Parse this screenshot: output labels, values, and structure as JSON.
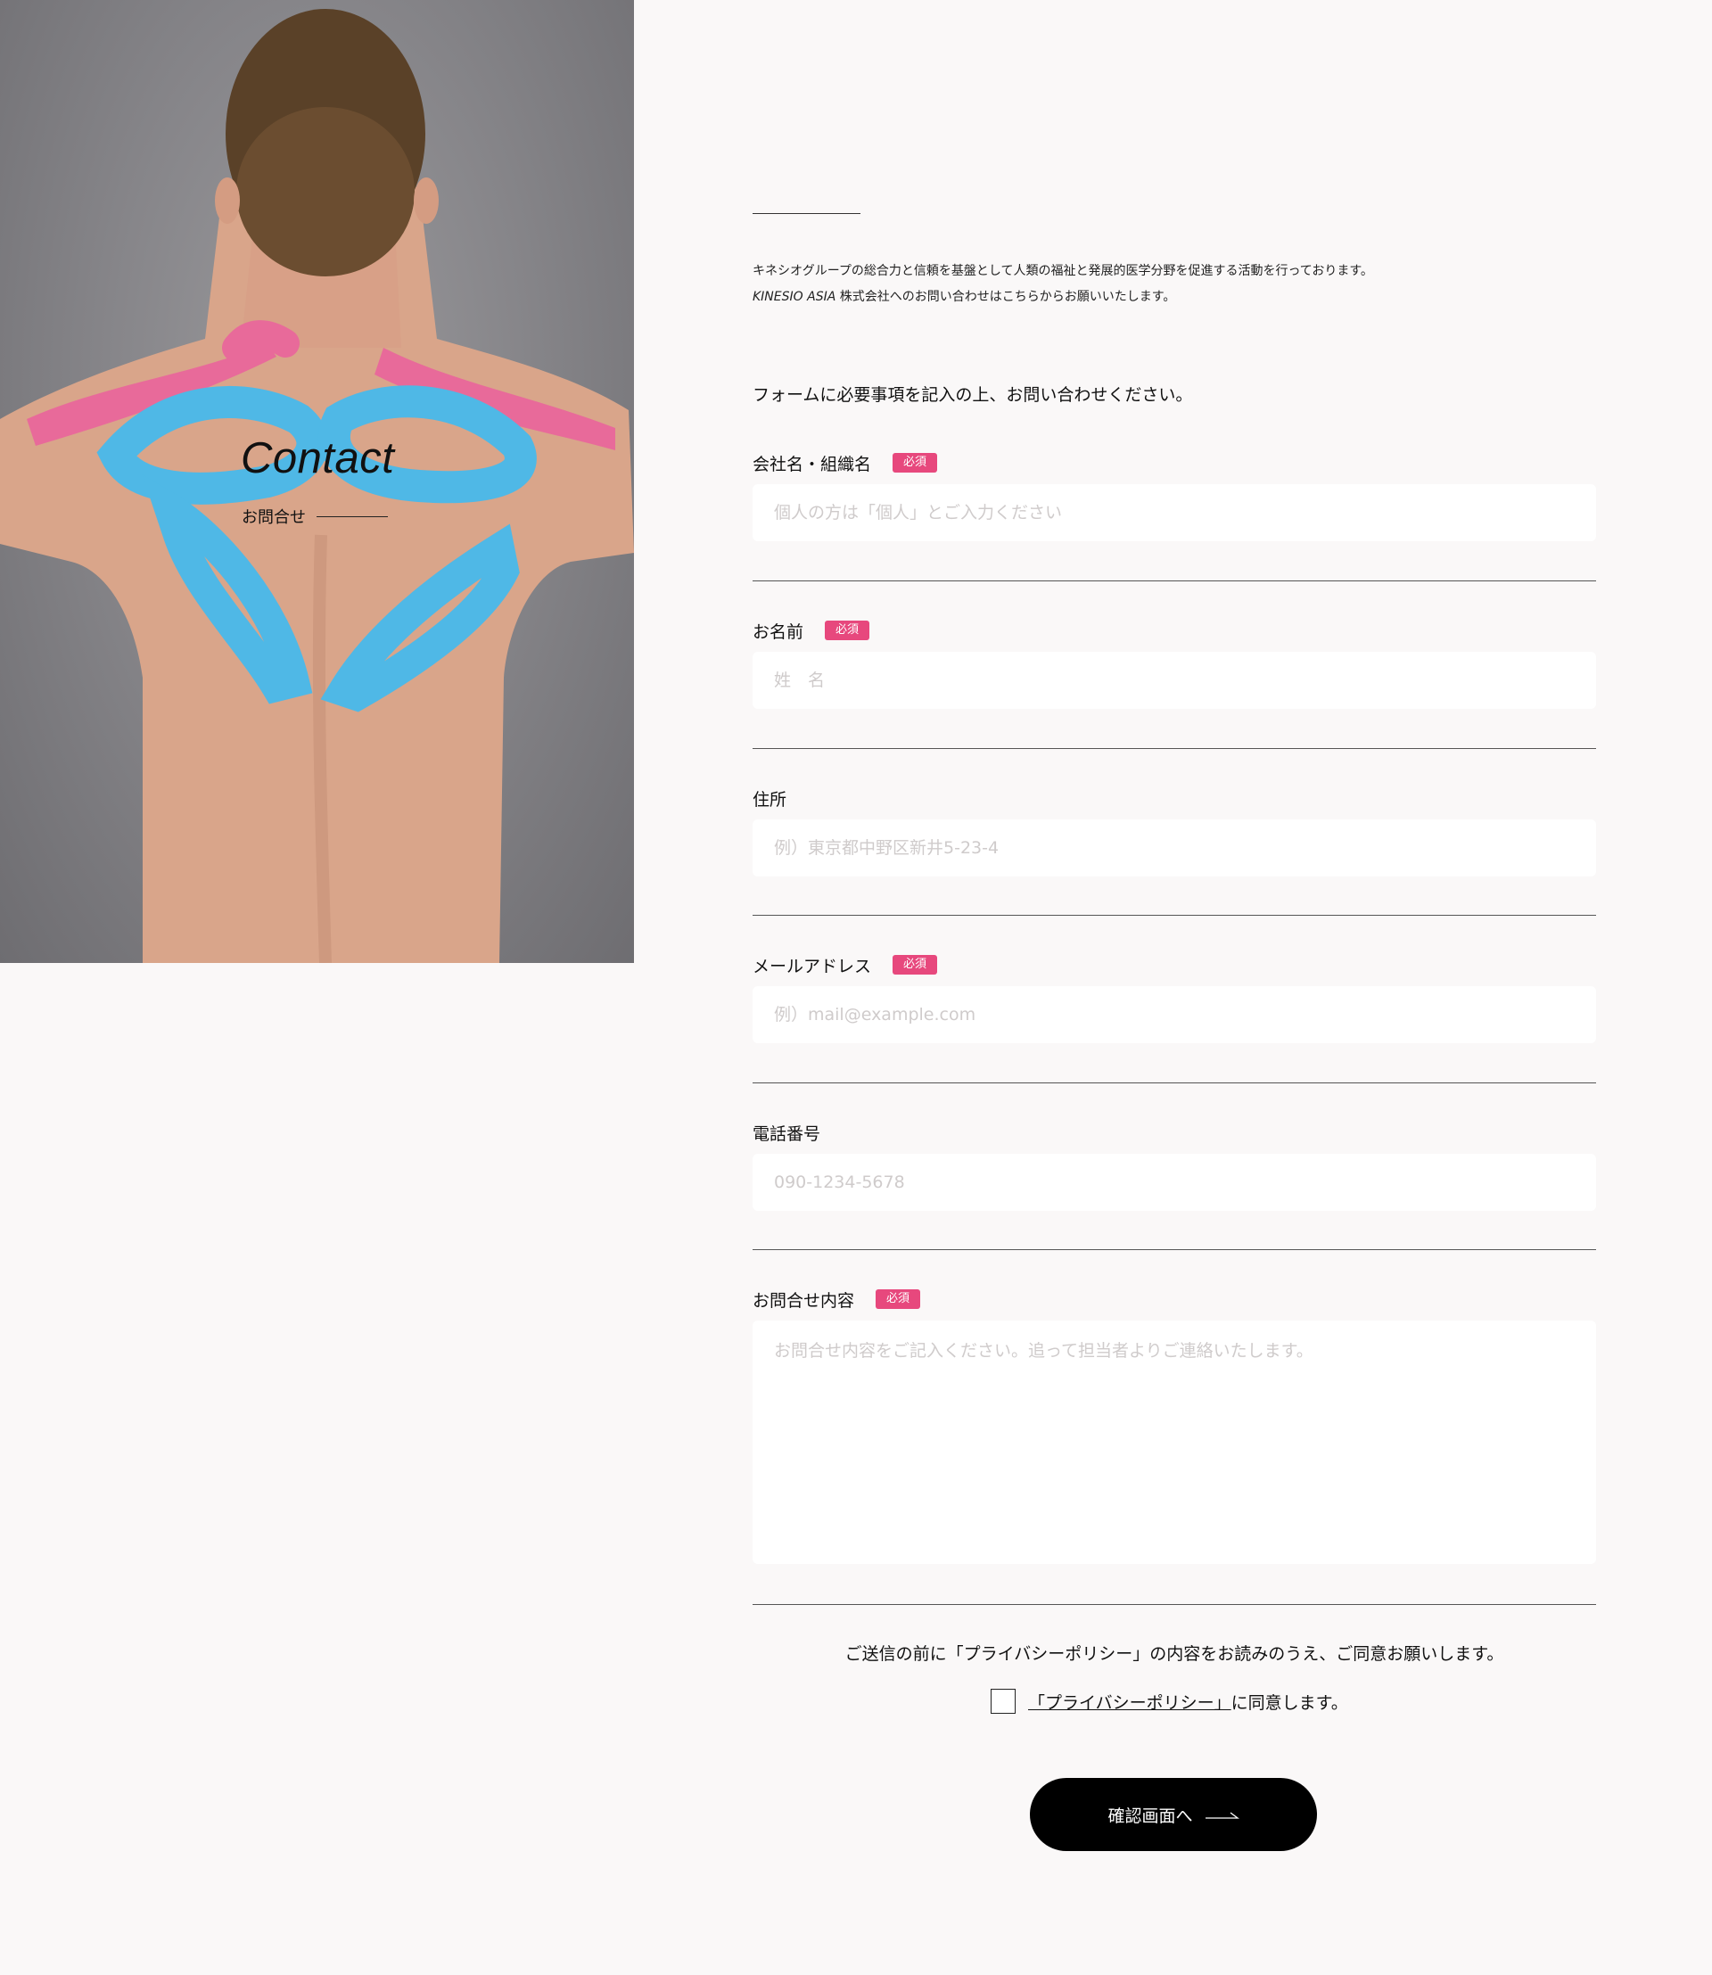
{
  "hero": {
    "title": "Contact",
    "subtitle": "お問合せ"
  },
  "intro": {
    "line1": "キネシオグループの総合力と信頼を基盤として人類の福祉と発展的医学分野を促進する活動を行っております。",
    "line2_brand": "KINESIO ASIA",
    "line2_rest": " 株式会社へのお問い合わせはこちらからお願いいたします。"
  },
  "lead": "フォームに必要事項を記入の上、お問い合わせください。",
  "required_label": "必須",
  "fields": {
    "company": {
      "label": "会社名・組織名",
      "placeholder": "個人の方は「個人」とご入力ください"
    },
    "name": {
      "label": "お名前",
      "placeholder": "姓　名"
    },
    "address": {
      "label": "住所",
      "placeholder": "例）東京都中野区新井5-23-4"
    },
    "email": {
      "label": "メールアドレス",
      "placeholder": "例）mail@example.com"
    },
    "phone": {
      "label": "電話番号",
      "placeholder": "090-1234-5678"
    },
    "inquiry": {
      "label": "お問合せ内容",
      "placeholder": "お問合せ内容をご記入ください。追って担当者よりご連絡いたします。"
    }
  },
  "consent": {
    "notice": "ご送信の前に「プライバシーポリシー」の内容をお読みのうえ、ご同意お願いします。",
    "link": "「プライバシーポリシー」",
    "suffix": "に同意します。",
    "checked": false
  },
  "submit": {
    "label": "確認画面へ"
  },
  "colors": {
    "background": "#faf8f8",
    "badge": "#e7487d",
    "button": "#000000",
    "tape_blue": "#4fb8e6",
    "tape_pink": "#e86a9a"
  }
}
